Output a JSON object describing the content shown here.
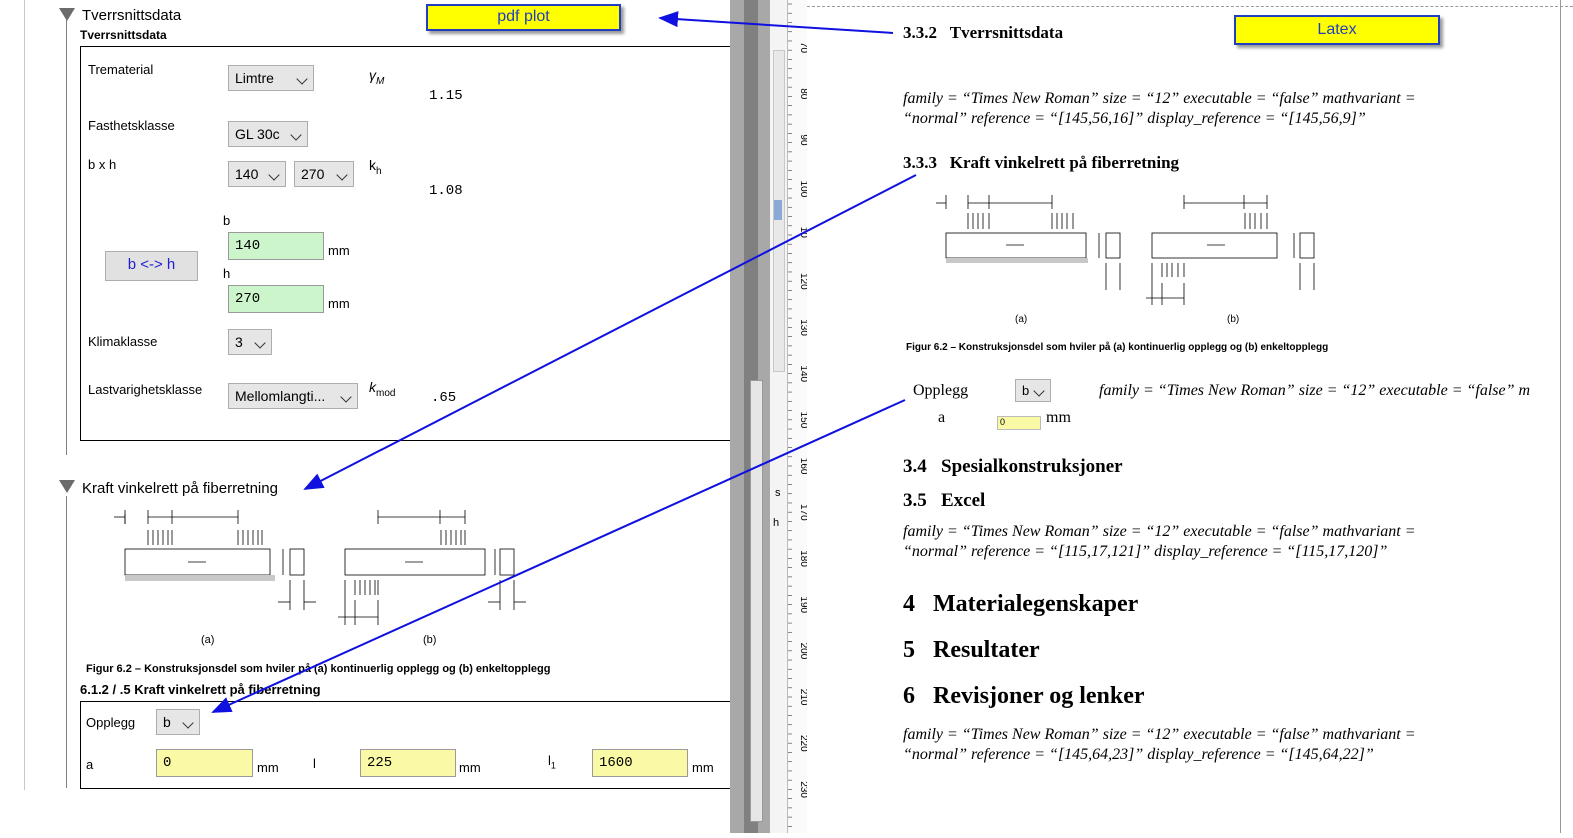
{
  "pdf_plot": {
    "tag": "pdf plot",
    "section1": {
      "title": "Tverrsnittsdata",
      "subtitle": "Tverrsnittsdata",
      "fields": {
        "trematerial_label": "Trematerial",
        "trematerial_value": "Limtre",
        "gamma_symbol": "γ",
        "gamma_sub": "M",
        "gamma_value": "1.15",
        "fasthet_label": "Fasthetsklasse",
        "fasthet_value": "GL 30c",
        "bxh_label": "b x h",
        "b_select": "140",
        "h_select": "270",
        "kh_symbol": "k",
        "kh_sub": "h",
        "kh_value": "1.08",
        "b_label": "b",
        "b_value": "140",
        "b_unit": "mm",
        "h_label": "h",
        "h_value": "270",
        "h_unit": "mm",
        "swap_button": "b <-> h",
        "klima_label": "Klimaklasse",
        "klima_value": "3",
        "last_label": "Lastvarighetsklasse",
        "last_value": "Mellomlangti...",
        "kmod_symbol": "k",
        "kmod_sub": "mod",
        "kmod_value": ".65"
      }
    },
    "section2": {
      "title": "Kraft vinkelrett på fiberretning",
      "fig_a": "(a)",
      "fig_b": "(b)",
      "caption": "Figur 6.2 – Konstruksjonsdel som hviler på (a) kontinuerlig opplegg og (b) enkeltopplegg",
      "subtitle": "6.1.2 / .5 Kraft vinkelrett på fiberretning",
      "opplegg_label": "Opplegg",
      "opplegg_value": "b",
      "a_label": "a",
      "a_value": "0",
      "a_unit": "mm",
      "l_label": "l",
      "l_value": "225",
      "l_unit": "mm",
      "l1_label": "l",
      "l1_sub": "1",
      "l1_value": "1600",
      "l1_unit": "mm"
    }
  },
  "ruler": {
    "labels": [
      "70",
      "80",
      "90",
      "100",
      "10",
      "120",
      "130",
      "140",
      "150",
      "160",
      "170",
      "180",
      "190",
      "200",
      "210",
      "220",
      "230"
    ]
  },
  "latex": {
    "tag": "Latex",
    "s332_num": "3.3.2",
    "s332_title": "Tverrsnittsdata",
    "m1_line1": "family = “Times New Roman” size = “12” executable = “false” mathvariant =",
    "m1_line2": "“normal” reference = “[145,56,16]” display_reference = “[145,56,9]”",
    "s333_num": "3.3.3",
    "s333_title": "Kraft vinkelrett på fiberretning",
    "fig_a": "(a)",
    "fig_b": "(b)",
    "caption": "Figur 6.2 – Konstruksjonsdel som hviler på (a) kontinuerlig opplegg og (b) enkeltopplegg",
    "opplegg_label": "Opplegg",
    "opplegg_value": "b",
    "opplegg_math": "family = “Times New Roman” size = “12” executable = “false” m",
    "a_label": "a",
    "a_value": "0",
    "a_unit": "mm",
    "s34_num": "3.4",
    "s34_title": "Spesialkonstruksjoner",
    "s35_num": "3.5",
    "s35_title": "Excel",
    "m2_line1": "family = “Times New Roman” size = “12” executable = “false” mathvariant =",
    "m2_line2": "“normal” reference = “[115,17,121]” display_reference = “[115,17,120]”",
    "s4_num": "4",
    "s4_title": "Materialegenskaper",
    "s5_num": "5",
    "s5_title": "Resultater",
    "s6_num": "6",
    "s6_title": "Revisjoner og lenker",
    "m3_line1": "family = “Times New Roman” size = “12” executable = “false” mathvariant =",
    "m3_line2": "“normal” reference = “[145,64,23]” display_reference = “[145,64,22]”"
  },
  "colors": {
    "tag_bg": "#ffff00",
    "tag_border": "#1f3fbf",
    "arrow": "#1010e0",
    "green_input": "#ccf5cc",
    "yellow_input": "#fafaa6"
  }
}
